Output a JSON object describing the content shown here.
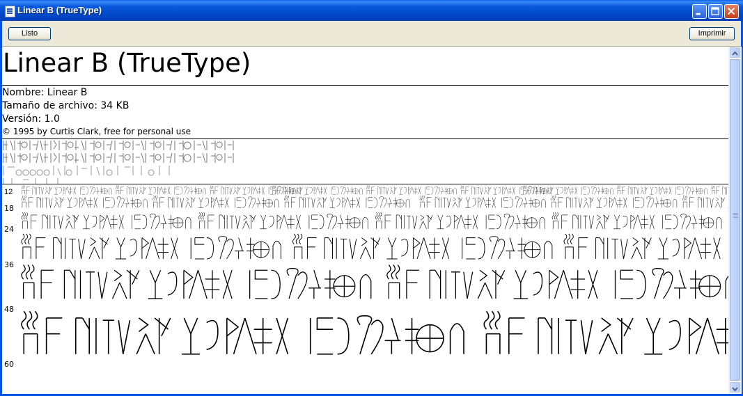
{
  "window": {
    "title": "Linear B (TrueType)",
    "colors": {
      "titlebar": "#0054E3",
      "close": "#C43C18",
      "face": "#ECE9D8"
    }
  },
  "toolbar": {
    "done_label": "Listo",
    "print_label": "Imprimir"
  },
  "font_info": {
    "heading": "Linear B (TrueType)",
    "name_line": "Nombre: Linear B",
    "size_line": "Tamaño de archivo: 34 KB",
    "version_line": "Versión: 1.0",
    "copyright_line": "© 1995 by Curtis Clark, free for personal use"
  },
  "preview": {
    "sizes": [
      "12",
      "18",
      "24",
      "36",
      "48",
      "60"
    ],
    "glyph_icon": "linear-b-glyphs"
  },
  "icons": {
    "app": "font-file-icon",
    "minimize": "minimize-icon",
    "maximize": "maximize-icon",
    "close": "close-icon",
    "scroll_up": "arrow-up-icon",
    "scroll_down": "arrow-down-icon"
  }
}
